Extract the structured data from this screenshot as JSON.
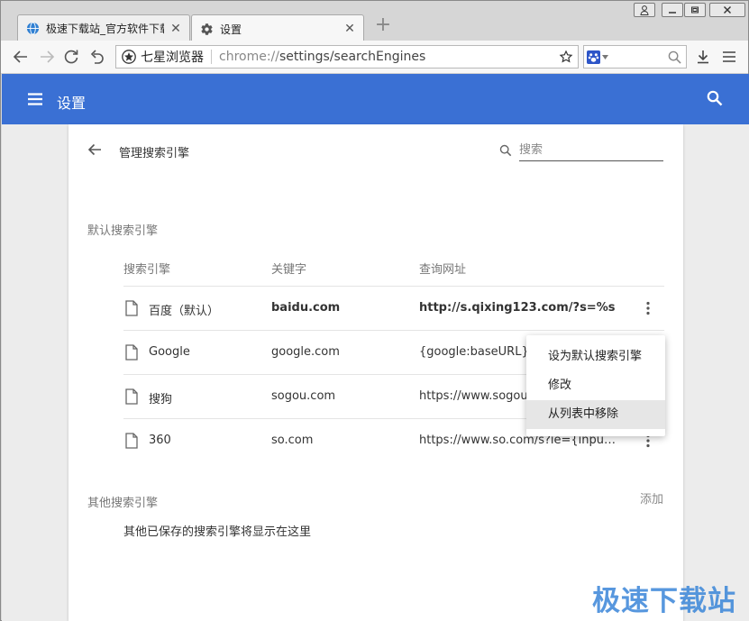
{
  "window": {
    "buttons": [
      "user",
      "minimize",
      "restore",
      "close"
    ]
  },
  "tabs": [
    {
      "label": "极速下载站_官方软件下载",
      "icon": "site-globe-icon",
      "active": false
    },
    {
      "label": "设置",
      "icon": "gear-icon",
      "active": true
    }
  ],
  "toolbar": {
    "browser_name": "七星浏览器",
    "url_scheme": "chrome://",
    "url_rest": "settings/searchEngines"
  },
  "header": {
    "title": "设置"
  },
  "subpage": {
    "title": "管理搜索引擎",
    "search_placeholder": "搜索"
  },
  "default_section": {
    "title": "默认搜索引擎",
    "columns": [
      "搜索引擎",
      "关键字",
      "查询网址"
    ],
    "engines": [
      {
        "name": "百度（默认）",
        "keyword": "baidu.com",
        "url": "http://s.qixing123.com/?s=%s",
        "is_default": true
      },
      {
        "name": "Google",
        "keyword": "google.com",
        "url": "{google:baseURL}search?q=%s",
        "is_default": false
      },
      {
        "name": "搜狗",
        "keyword": "sogou.com",
        "url": "https://www.sogou.com/web?query=%s",
        "is_default": false
      },
      {
        "name": "360",
        "keyword": "so.com",
        "url": "https://www.so.com/s?ie={inputEnc...",
        "is_default": false
      }
    ]
  },
  "other_section": {
    "title": "其他搜索引擎",
    "add_label": "添加",
    "empty_text": "其他已保存的搜索引擎将显示在这里"
  },
  "context_menu": {
    "items": [
      "设为默认搜索引擎",
      "修改",
      "从列表中移除"
    ],
    "highlighted_index": 2
  },
  "watermark": "极速下载站",
  "colors": {
    "header_blue": "#3a70d4",
    "watermark_blue": "#3a86d9"
  }
}
